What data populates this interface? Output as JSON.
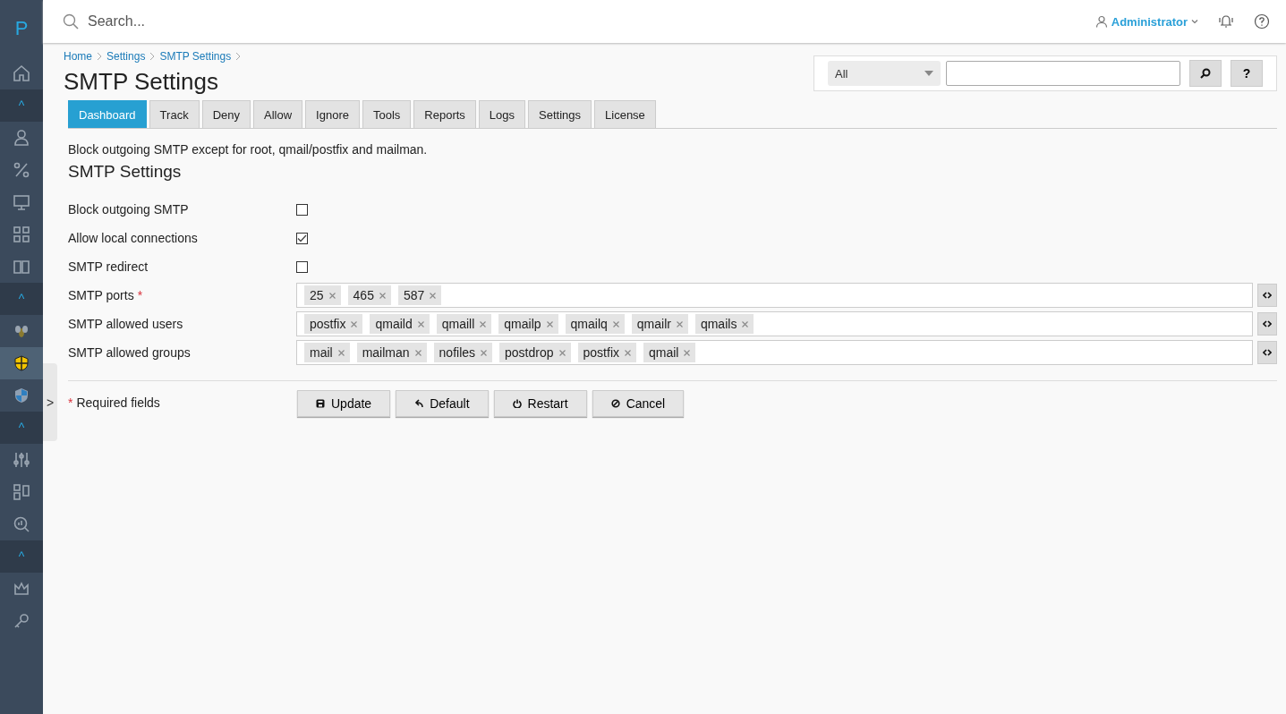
{
  "sidebar": {
    "logo": "P",
    "items": [
      {
        "kind": "link",
        "selected": false
      },
      {
        "kind": "toggle",
        "label": "^"
      },
      {
        "kind": "link",
        "selected": false
      },
      {
        "kind": "link",
        "selected": false
      },
      {
        "kind": "link",
        "selected": false
      },
      {
        "kind": "link",
        "selected": false
      },
      {
        "kind": "link",
        "selected": false
      },
      {
        "kind": "toggle",
        "label": "^"
      },
      {
        "kind": "link",
        "selected": false
      },
      {
        "kind": "link",
        "selected": true
      },
      {
        "kind": "link",
        "selected": false
      },
      {
        "kind": "toggle",
        "label": "^"
      },
      {
        "kind": "link",
        "selected": false
      },
      {
        "kind": "link",
        "selected": false
      },
      {
        "kind": "link",
        "selected": false
      },
      {
        "kind": "toggle",
        "label": "^"
      },
      {
        "kind": "link",
        "selected": false
      },
      {
        "kind": "link",
        "selected": false
      }
    ],
    "expand_handle": ">"
  },
  "topbar": {
    "search": {
      "placeholder": "Search..."
    },
    "user": "Administrator"
  },
  "breadcrumbs": [
    "Home",
    "Settings",
    "SMTP Settings"
  ],
  "title": "SMTP Settings",
  "filter": {
    "scope": "All",
    "help": "?"
  },
  "required_marker": "*",
  "tabs": [
    {
      "label": "Dashboard",
      "selected": true
    },
    {
      "label": "Track",
      "selected": false
    },
    {
      "label": "Deny",
      "selected": false
    },
    {
      "label": "Allow",
      "selected": false
    },
    {
      "label": "Ignore",
      "selected": false
    },
    {
      "label": "Tools",
      "selected": false
    },
    {
      "label": "Reports",
      "selected": false
    },
    {
      "label": "Logs",
      "selected": false
    },
    {
      "label": "Settings",
      "selected": false
    },
    {
      "label": "License",
      "selected": false
    }
  ],
  "description": "Block outgoing SMTP except for root, qmail/postfix and mailman.",
  "section_title": "SMTP Settings",
  "fields": [
    {
      "kind": "checkbox",
      "label": "Block outgoing SMTP",
      "required": false,
      "checked": false
    },
    {
      "kind": "checkbox",
      "label": "Allow local connections",
      "required": false,
      "checked": true
    },
    {
      "kind": "checkbox",
      "label": "SMTP redirect",
      "required": false,
      "checked": false
    },
    {
      "kind": "tags",
      "label": "SMTP ports",
      "required": true,
      "tags": [
        "25",
        "465",
        "587"
      ]
    },
    {
      "kind": "tags",
      "label": "SMTP allowed users",
      "required": false,
      "tags": [
        "postfix",
        "qmaild",
        "qmaill",
        "qmailp",
        "qmailq",
        "qmailr",
        "qmails"
      ]
    },
    {
      "kind": "tags",
      "label": "SMTP allowed groups",
      "required": false,
      "tags": [
        "mail",
        "mailman",
        "nofiles",
        "postdrop",
        "postfix",
        "qmail"
      ]
    }
  ],
  "required_note": "Required fields",
  "buttons": [
    {
      "kind": "update",
      "label": "Update"
    },
    {
      "kind": "default",
      "label": "Default"
    },
    {
      "kind": "restart",
      "label": "Restart"
    },
    {
      "kind": "cancel",
      "label": "Cancel"
    }
  ]
}
